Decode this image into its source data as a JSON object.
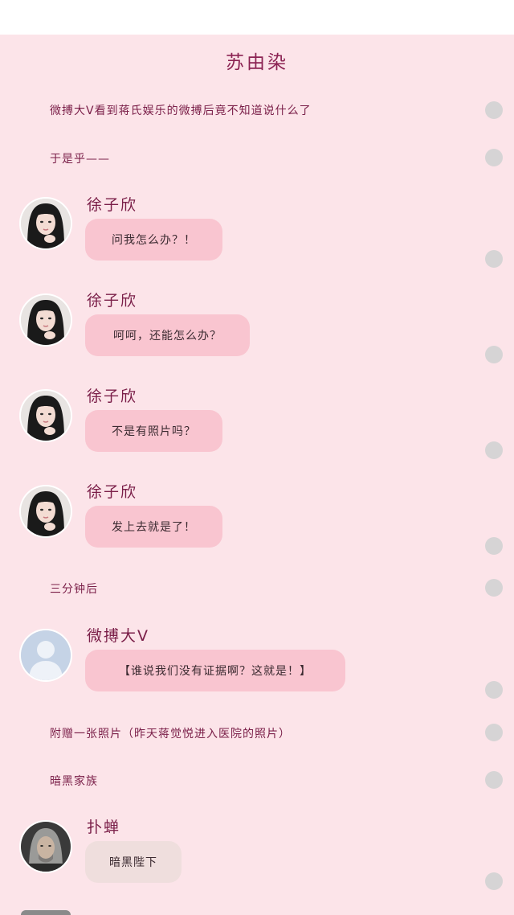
{
  "page": {
    "title": "苏由染"
  },
  "messages": [
    {
      "type": "narration",
      "text": "微搏大V看到蒋氏娱乐的微搏后竟不知道说什么了"
    },
    {
      "type": "narration",
      "text": "于是乎——"
    },
    {
      "type": "chat",
      "sender": "徐子欣",
      "text": "问我怎么办？！",
      "avatar": "girl-avatar"
    },
    {
      "type": "chat",
      "sender": "徐子欣",
      "text": "呵呵，还能怎么办？",
      "avatar": "girl-avatar"
    },
    {
      "type": "chat",
      "sender": "徐子欣",
      "text": "不是有照片吗？",
      "avatar": "girl-avatar"
    },
    {
      "type": "chat",
      "sender": "徐子欣",
      "text": "发上去就是了！",
      "avatar": "girl-avatar"
    },
    {
      "type": "narration",
      "text": "三分钟后"
    },
    {
      "type": "chat",
      "sender": "微搏大V",
      "text": "【谁说我们没有证据啊？这就是！】",
      "avatar": "default-user-avatar"
    },
    {
      "type": "narration",
      "text": "附赠一张照片（昨天蒋觉悦进入医院的照片）"
    },
    {
      "type": "narration",
      "text": "暗黑家族"
    },
    {
      "type": "chat",
      "sender": "扑蝉",
      "text": "暗黑陛下",
      "avatar": "warrior-avatar"
    }
  ],
  "colors": {
    "background": "#fce4e9",
    "bubble_pink": "#f9c5d0",
    "bubble_beige": "#efdedd",
    "text_accent": "#7a1e48",
    "dot": "#d6d4d5"
  }
}
